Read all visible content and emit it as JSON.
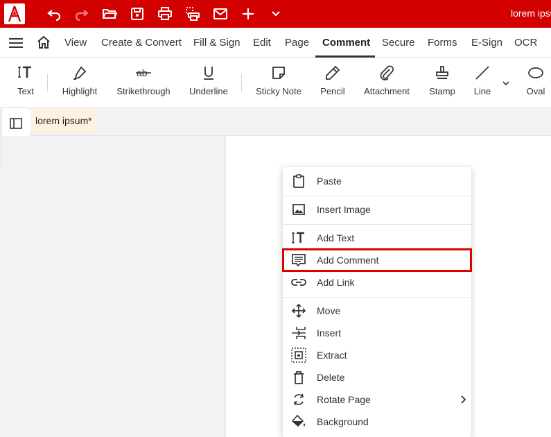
{
  "app": {
    "title_text": "lorem ipsum",
    "accent": "#d30000"
  },
  "titlebar": {
    "icons": [
      "app-logo",
      "undo-icon",
      "redo-icon",
      "open-folder-icon",
      "save-icon",
      "print-icon",
      "print-layout-icon",
      "mail-icon",
      "plus-icon",
      "chevron-down-icon"
    ]
  },
  "menubar": {
    "items": [
      {
        "label": "View"
      },
      {
        "label": "Create & Convert"
      },
      {
        "label": "Fill & Sign"
      },
      {
        "label": "Edit"
      },
      {
        "label": "Page"
      },
      {
        "label": "Comment"
      },
      {
        "label": "Secure"
      },
      {
        "label": "Forms"
      },
      {
        "label": "E-Sign"
      },
      {
        "label": "OCR"
      }
    ],
    "active": "Comment"
  },
  "toolbar": {
    "tools": [
      {
        "label": "Text",
        "icon": "text-icon"
      },
      {
        "label": "Highlight",
        "icon": "highlight-icon"
      },
      {
        "label": "Strikethrough",
        "icon": "strikethrough-icon"
      },
      {
        "label": "Underline",
        "icon": "underline-icon"
      },
      {
        "label": "Sticky Note",
        "icon": "sticky-note-icon"
      },
      {
        "label": "Pencil",
        "icon": "pencil-icon"
      },
      {
        "label": "Attachment",
        "icon": "attachment-icon"
      },
      {
        "label": "Stamp",
        "icon": "stamp-icon"
      },
      {
        "label": "Line",
        "icon": "line-icon"
      },
      {
        "label": "Oval",
        "icon": "oval-icon"
      }
    ]
  },
  "document": {
    "tab_label": "lorem ipsum*"
  },
  "context_menu": {
    "items": [
      {
        "label": "Paste",
        "icon": "clipboard-icon"
      },
      {
        "label": "Insert Image",
        "icon": "image-icon"
      },
      {
        "label": "Add Text",
        "icon": "text-icon"
      },
      {
        "label": "Add Comment",
        "icon": "comment-icon",
        "highlighted": true
      },
      {
        "label": "Add Link",
        "icon": "link-icon"
      },
      {
        "label": "Move",
        "icon": "move-icon"
      },
      {
        "label": "Insert",
        "icon": "insert-page-icon"
      },
      {
        "label": "Extract",
        "icon": "extract-icon"
      },
      {
        "label": "Delete",
        "icon": "trash-icon"
      },
      {
        "label": "Rotate Page",
        "icon": "rotate-icon",
        "has_submenu": true
      },
      {
        "label": "Background",
        "icon": "paint-bucket-icon"
      }
    ],
    "highlight_color": "#e00000"
  }
}
